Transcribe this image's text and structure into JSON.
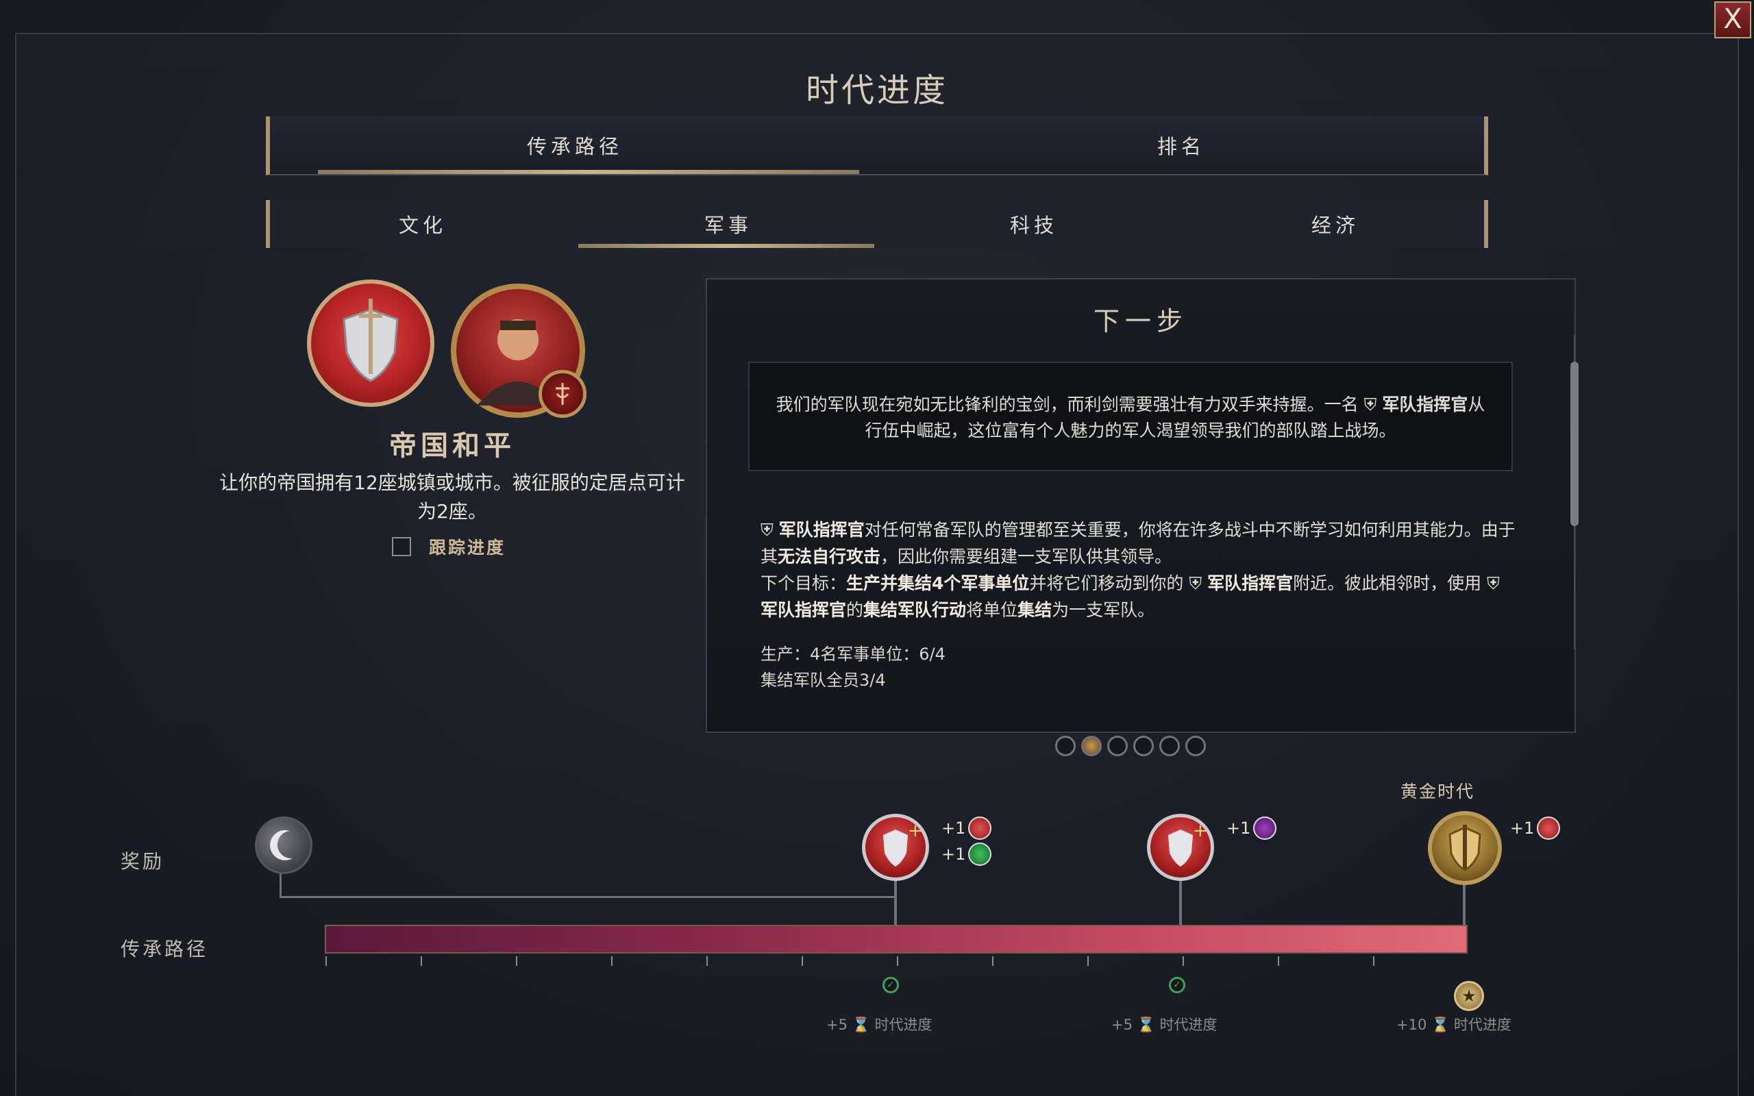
{
  "window": {
    "title": "时代进度",
    "close_label": "X"
  },
  "main_tabs": [
    {
      "label": "传承路径",
      "active": true
    },
    {
      "label": "排名",
      "active": false
    }
  ],
  "sub_tabs": [
    {
      "label": "文化",
      "active": false
    },
    {
      "label": "军事",
      "active": true
    },
    {
      "label": "科技",
      "active": false
    },
    {
      "label": "经济",
      "active": false
    }
  ],
  "goal": {
    "title": "帝国和平",
    "description": "让你的帝国拥有12座城镇或城市。被征服的定居点可计为2座。",
    "track_label": "跟踪进度",
    "track_checked": false,
    "icons": [
      "sword-shield-laurel-icon",
      "commander-portrait-icon",
      "army-badge-icon"
    ]
  },
  "next_step": {
    "title": "下一步",
    "quote_part1": "我们的军队现在宛如无比锋利的宝剑，而利剑需要强壮有力双手来持握。一名",
    "quote_bold": "军队指挥官",
    "quote_part2": "从行伍中崛起，这位富有个人魅力的军人渴望领导我们的部队踏上战场。",
    "p1_bold": "军队指挥官",
    "p1_text": "对任何常备军队的管理都至关重要，你将在许多战斗中不断学习如何利用其能力。由于其",
    "p1_bold2": "无法自行攻击",
    "p1_text2": "，因此你需要组建一支军队供其领导。",
    "p2_prefix": "下个目标：",
    "p2_bold": "生产并集结4个军事单位",
    "p2_text": "并将它们移动到你的",
    "p2_bold2": "军队指挥官",
    "p2_text2": "附近。彼此相邻时，使用",
    "p2_bold3": "军队指挥官",
    "p2_text3": "的",
    "p2_bold4": "集结军队行动",
    "p2_text4": "将单位",
    "p2_bold5": "集结",
    "p2_text5": "为一支军队。",
    "stat1": "生产：4名军事单位：6/4",
    "stat2": "集结军队全员3/4"
  },
  "pagination": {
    "count": 6,
    "active_index": 1
  },
  "rows": {
    "rewards_label": "奖励",
    "path_label": "传承路径"
  },
  "progress": {
    "fraction": 1.0
  },
  "milestones": [
    {
      "bonus_a": "+1",
      "bonus_b": "+1",
      "age_points": "+5",
      "age_label": "时代进度"
    },
    {
      "bonus_a": "+1",
      "age_points": "+5",
      "age_label": "时代进度"
    },
    {
      "bonus_a": "+1",
      "age_points": "+10",
      "age_label": "时代进度",
      "title": "黄金时代"
    }
  ],
  "colors": {
    "accent_gold": "#c9b58c",
    "bar_start": "#5b1a3a",
    "bar_end": "#e06a78",
    "check_green": "#3fa25a"
  }
}
